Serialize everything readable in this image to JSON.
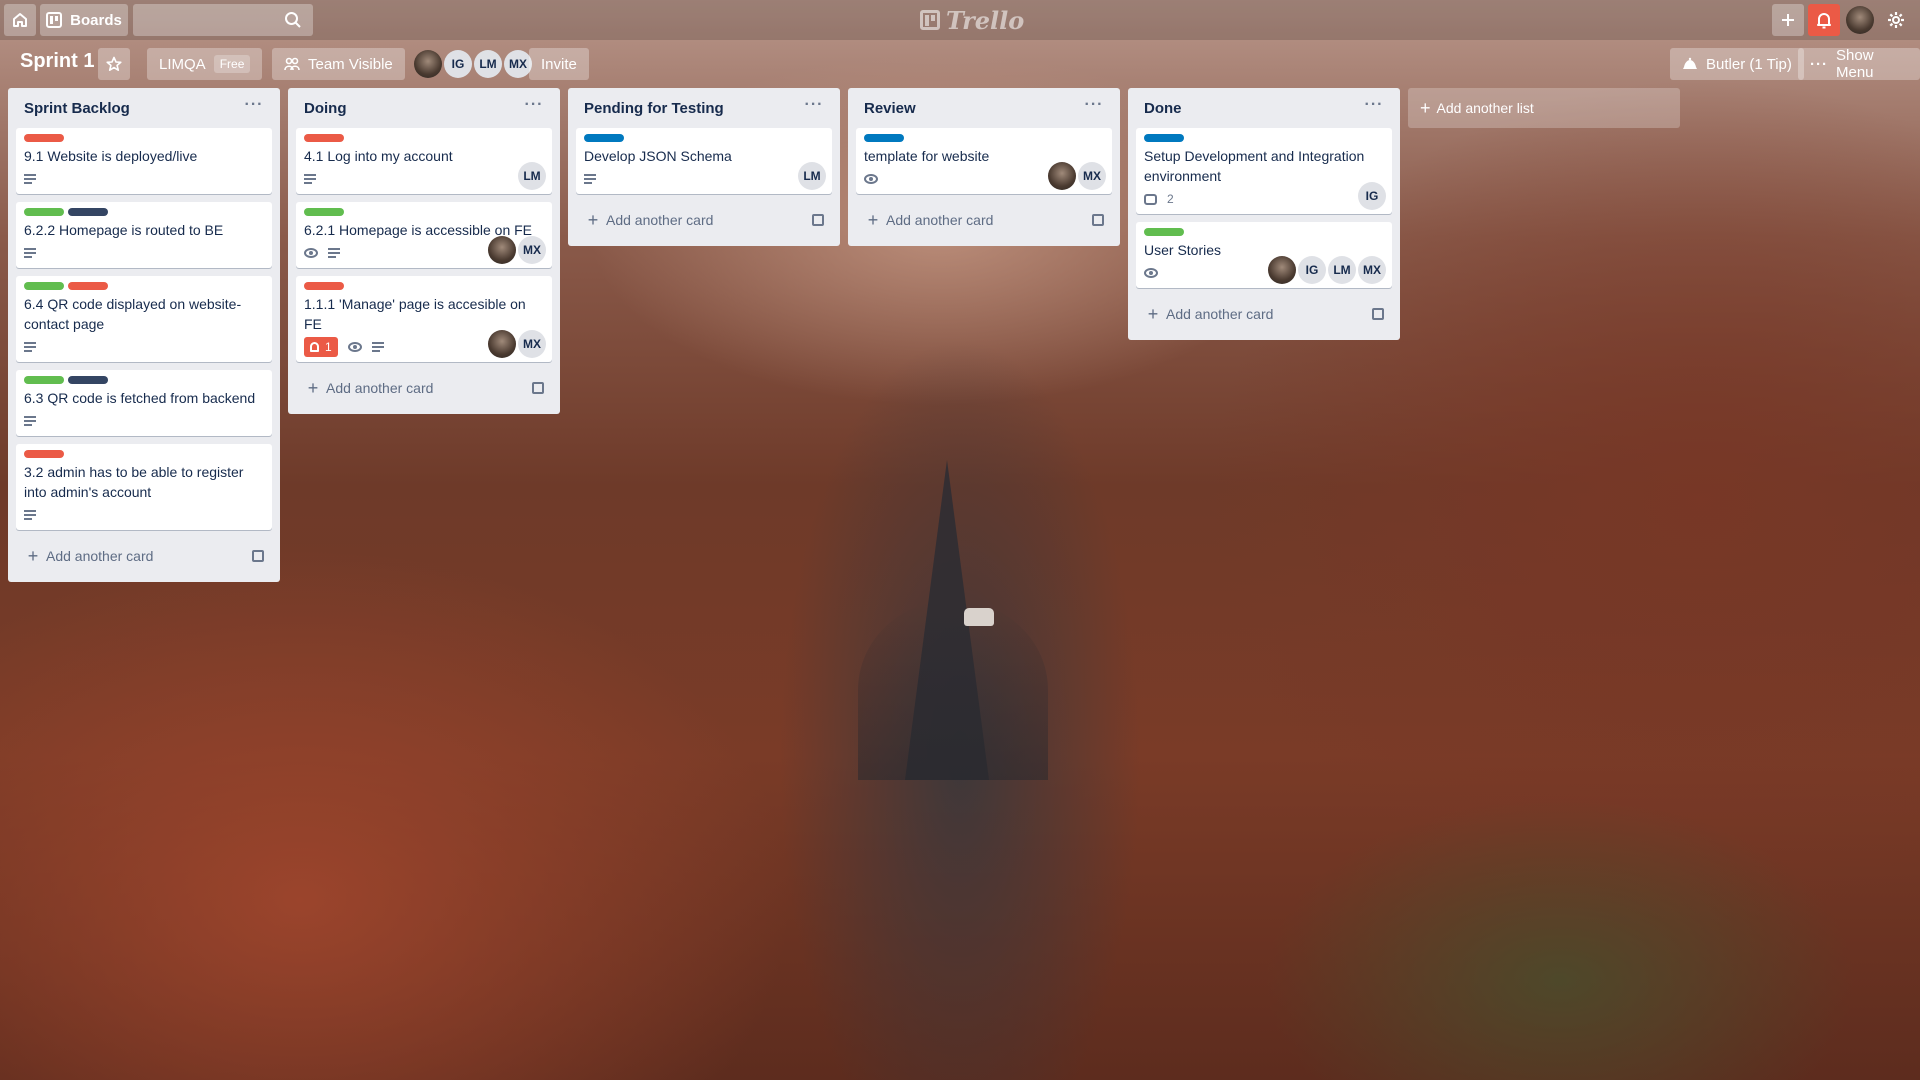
{
  "header": {
    "boards_label": "Boards",
    "search_placeholder": "",
    "logo_text": "Trello"
  },
  "board": {
    "title": "Sprint 1",
    "team_name": "LIMQA",
    "team_badge": "Free",
    "visibility": "Team Visible",
    "members": [
      "IG",
      "LM",
      "MX"
    ],
    "invite_label": "Invite",
    "butler_label": "Butler (1 Tip)",
    "show_menu_label": "Show Menu"
  },
  "add_card_label": "Add another card",
  "add_list_label": "Add another list",
  "lists": [
    {
      "title": "Sprint Backlog",
      "cards": [
        {
          "labels": [
            "red"
          ],
          "title": "9.1 Website is deployed/live",
          "has_desc": true
        },
        {
          "labels": [
            "green",
            "navy"
          ],
          "title": "6.2.2 Homepage is routed to BE",
          "has_desc": true
        },
        {
          "labels": [
            "green",
            "red"
          ],
          "title": "6.4 QR code displayed on website-contact page",
          "has_desc": true
        },
        {
          "labels": [
            "green",
            "navy"
          ],
          "title": "6.3 QR code is fetched from backend",
          "has_desc": true
        },
        {
          "labels": [
            "red"
          ],
          "title": "3.2 admin has to be able to register into admin's account",
          "has_desc": true
        }
      ]
    },
    {
      "title": "Doing",
      "cards": [
        {
          "labels": [
            "red"
          ],
          "title": "4.1 Log into my account",
          "has_desc": true,
          "members": [
            "LM"
          ]
        },
        {
          "labels": [
            "green"
          ],
          "title": "6.2.1 Homepage is accessible on FE",
          "watch": true,
          "has_desc": true,
          "members": [
            "photo",
            "MX"
          ]
        },
        {
          "labels": [
            "red"
          ],
          "title": "1.1.1 'Manage' page is accesible on FE",
          "notifications": "1",
          "watch": true,
          "has_desc": true,
          "members": [
            "photo",
            "MX"
          ]
        }
      ]
    },
    {
      "title": "Pending for Testing",
      "cards": [
        {
          "labels": [
            "blue"
          ],
          "title": "Develop JSON Schema",
          "has_desc": true,
          "members": [
            "LM"
          ]
        }
      ]
    },
    {
      "title": "Review",
      "cards": [
        {
          "labels": [
            "blue"
          ],
          "title": "template for website",
          "watch": true,
          "members": [
            "photo",
            "MX"
          ]
        }
      ]
    },
    {
      "title": "Done",
      "cards": [
        {
          "labels": [
            "blue"
          ],
          "title": "Setup Development and Integration environment",
          "comments": "2",
          "members": [
            "IG"
          ]
        },
        {
          "labels": [
            "green"
          ],
          "title": "User Stories",
          "watch": true,
          "members": [
            "photo",
            "IG",
            "LM",
            "MX"
          ]
        }
      ]
    }
  ],
  "colors": {
    "red": "#eb5a46",
    "green": "#61bd4f",
    "navy": "#344563",
    "blue": "#0079bf",
    "notification": "#eb5a46"
  }
}
